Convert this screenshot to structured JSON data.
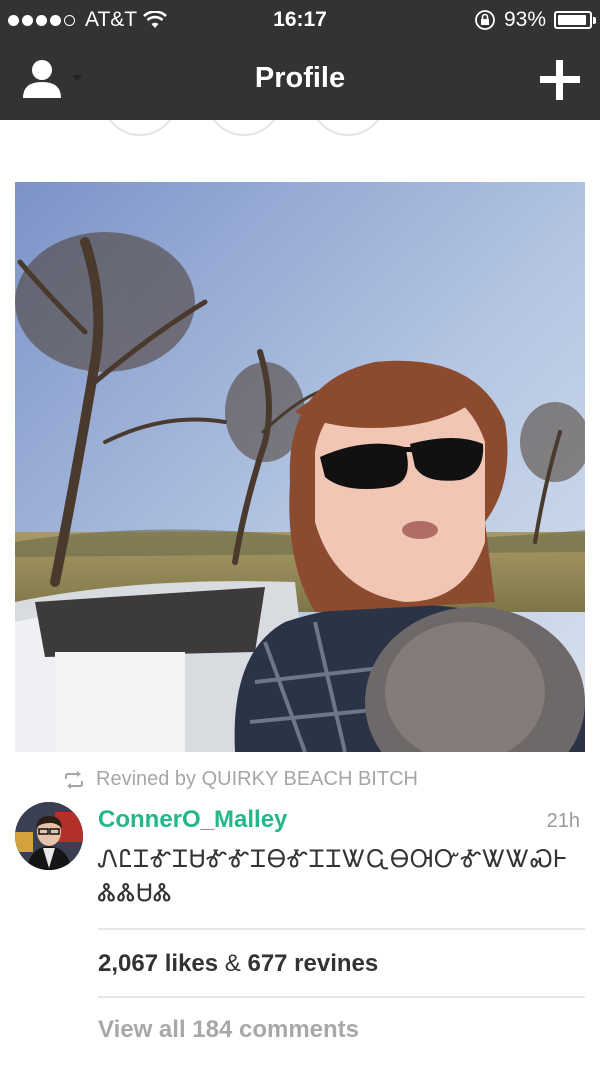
{
  "status_bar": {
    "signal_dots": [
      true,
      true,
      true,
      true,
      false
    ],
    "carrier": "AT&T",
    "time": "16:17",
    "battery_percent_text": "93%",
    "battery_level": 0.93,
    "icons": [
      "wifi-icon",
      "rotation-lock-icon",
      "battery-icon"
    ]
  },
  "nav": {
    "title": "Profile",
    "left_icon": "person-icon",
    "right_icon": "plus-icon"
  },
  "post": {
    "revined_by": "Revined by QUIRKY BEACH BITCH",
    "username": "ConnerO_Malley",
    "time_ago": "21h",
    "caption": "ᏁᏝᏆᎹᏆᏌᎹᎹᏆᎾᎹᏆᏆᏔᏩᎾᎺᏅᎹᏔᏔᏍᎰᏜᏜᏌᏜ",
    "likes_count": "2,067 likes",
    "stats_sep": "&",
    "revines_count": "677 revines",
    "view_all_comments": "View all 184 comments"
  },
  "colors": {
    "bar_bg": "#333333",
    "username_green": "#25b68a",
    "muted_gray": "#a8a8a8"
  }
}
